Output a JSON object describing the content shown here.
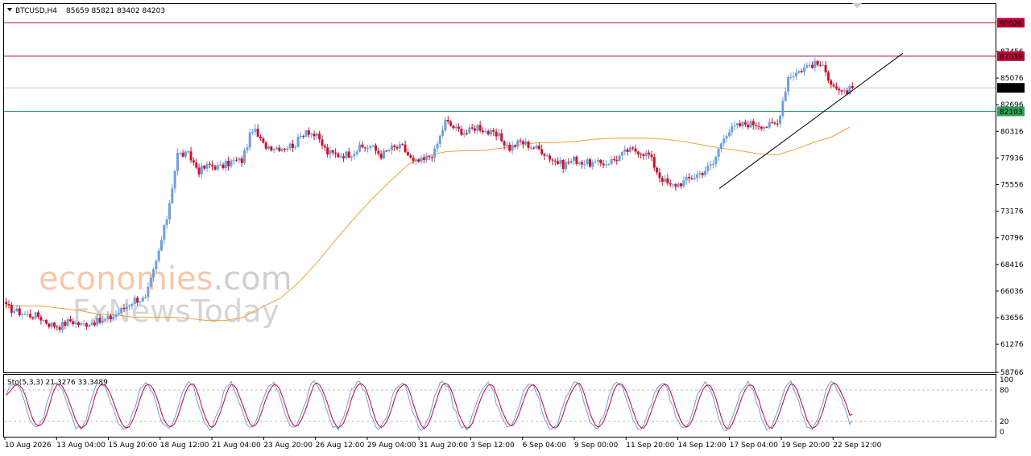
{
  "header": {
    "symbol": "BTCUSD,H4",
    "ohlc": "85659 85821 83402 84203"
  },
  "oscillator": {
    "label": "Sto(5,3,3) 21.3276 33.3489",
    "levels": [
      "100",
      "80",
      "20",
      "0"
    ]
  },
  "watermark": {
    "line1": "economies.com",
    "line2": "FxNewsToday"
  },
  "price_axis": {
    "ticks": [
      "87456",
      "85076",
      "82696",
      "80316",
      "77936",
      "75556",
      "73176",
      "70796",
      "68416",
      "66036",
      "63656",
      "61276",
      "58766"
    ]
  },
  "price_labels": {
    "resistance_high": "90026",
    "resistance": "87039",
    "current": "84203",
    "support": "82103"
  },
  "time_axis": {
    "labels": [
      "10 Aug 2026",
      "13 Aug 04:00",
      "15 Aug 20:00",
      "18 Aug 12:00",
      "21 Aug 04:00",
      "23 Aug 20:00",
      "26 Aug 12:00",
      "29 Aug 04:00",
      "31 Aug 20:00",
      "3 Sep 12:00",
      "6 Sep 04:00",
      "9 Sep 00:00",
      "11 Sep 20:00",
      "14 Sep 12:00",
      "17 Sep 04:00",
      "19 Sep 20:00",
      "22 Sep 12:00"
    ]
  },
  "colors": {
    "bull": "#6f9ee0",
    "bear": "#d0102a",
    "ma": "#f0a040",
    "resistance": "#c0003a",
    "support": "#2ca05a",
    "current": "#000000",
    "stoch_main": "#6f9ee0",
    "stoch_signal": "#c0003a",
    "watermark_orange": "#f6c8a8",
    "watermark_gray": "#cfcfcf"
  },
  "chart_data": [
    {
      "type": "candlestick",
      "title": "BTCUSD,H4",
      "ohlc_last": [
        85659,
        85821,
        83402,
        84203
      ],
      "ylim": [
        58766,
        91700
      ],
      "x": [
        "10 Aug 2026",
        "13 Aug 04:00",
        "15 Aug 20:00",
        "18 Aug 12:00",
        "21 Aug 04:00",
        "23 Aug 20:00",
        "26 Aug 12:00",
        "29 Aug 04:00",
        "31 Aug 20:00",
        "3 Sep 12:00",
        "6 Sep 04:00",
        "9 Sep 00:00",
        "11 Sep 20:00",
        "14 Sep 12:00",
        "17 Sep 04:00",
        "19 Sep 20:00",
        "22 Sep 12:00"
      ],
      "path_close": [
        64600,
        64200,
        63900,
        63800,
        63100,
        62900,
        63400,
        63000,
        63300,
        63300,
        63800,
        64500,
        65300,
        65300,
        68600,
        72600,
        78300,
        78200,
        76800,
        77300,
        77100,
        77600,
        77700,
        80600,
        79100,
        78900,
        78900,
        79200,
        80500,
        79800,
        78400,
        78200,
        78300,
        78800,
        79000,
        78200,
        78800,
        78900,
        77500,
        77700,
        78500,
        81200,
        80500,
        80200,
        80800,
        80200,
        79800,
        78800,
        79400,
        79000,
        78600,
        77800,
        77300,
        77800,
        77500,
        77400,
        77500,
        77900,
        78600,
        78600,
        78200,
        76300,
        75400,
        75700,
        76200,
        76700,
        77400,
        80000,
        80700,
        81000,
        81000,
        80800,
        81000,
        85200,
        85700,
        86300,
        86300,
        84800,
        83600,
        84203
      ],
      "levels": {
        "resistance_high": 90026,
        "resistance": 87039,
        "current": 84203,
        "support": 82103
      },
      "ma": [
        64800,
        64700,
        64700,
        64500,
        64300,
        64000,
        63900,
        63700,
        63700,
        63700,
        63600,
        63400,
        63400,
        63700,
        64600,
        65400,
        66800,
        68600,
        70600,
        72500,
        74300,
        75900,
        77400,
        78100,
        78500,
        78600,
        78600,
        78800,
        79100,
        79300,
        79300,
        79400,
        79600,
        79700,
        79700,
        79700,
        79600,
        79400,
        79100,
        78800,
        78600,
        78300,
        78200,
        78700,
        79300,
        79800,
        80700
      ],
      "trendline": [
        [
          75200,
          "14 Sep 12:00"
        ],
        [
          87300,
          "22 Sep 12:00 +"
        ]
      ]
    },
    {
      "type": "line",
      "title": "Sto(5,3,3) 21.3276 33.3489",
      "ylim": [
        0,
        100
      ],
      "levels": [
        20,
        80
      ],
      "series": [
        {
          "name": "Sto main",
          "values": [
            21.3276
          ]
        },
        {
          "name": "Sto signal",
          "values": [
            33.3489
          ]
        }
      ]
    }
  ]
}
